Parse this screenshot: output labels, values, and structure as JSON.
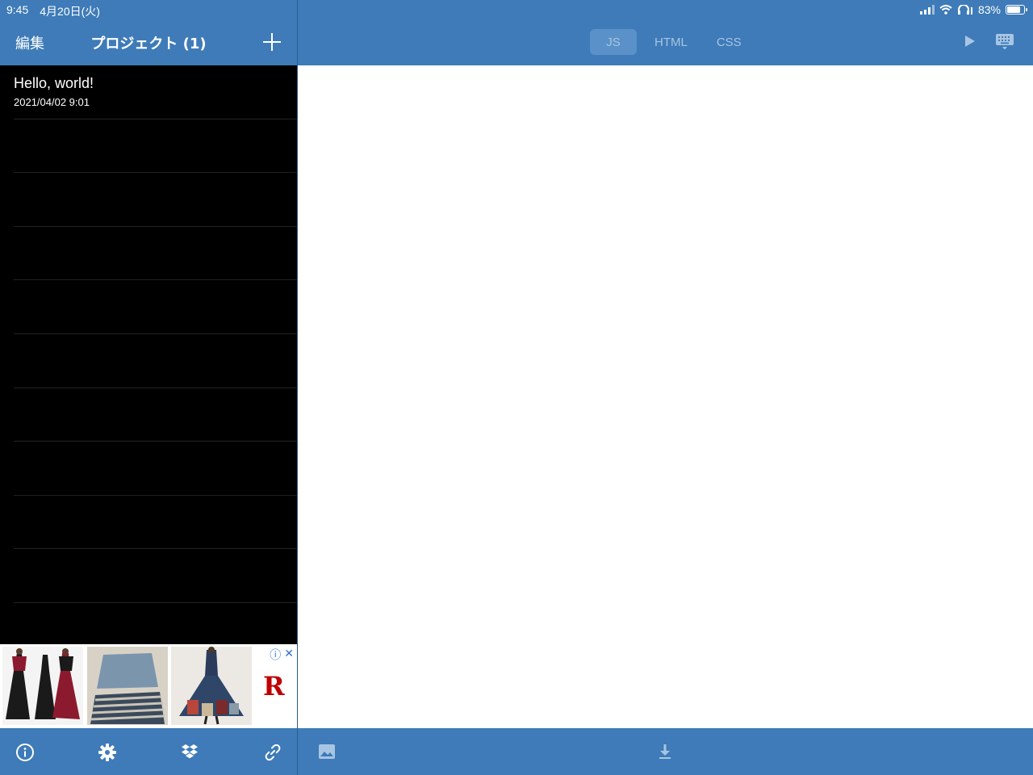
{
  "status_bar": {
    "time": "9:45",
    "date": "4月20日(火)",
    "battery": "83%",
    "battery_level": 0.83
  },
  "sidebar": {
    "edit_label": "編集",
    "title": "プロジェクト (1)",
    "projects": [
      {
        "name": "Hello, world!",
        "date": "2021/04/02 9:01"
      }
    ]
  },
  "editor": {
    "tabs": [
      {
        "label": "JS",
        "active": true
      },
      {
        "label": "HTML",
        "active": false
      },
      {
        "label": "CSS",
        "active": false
      }
    ]
  },
  "colors": {
    "header_bg": "#3e7bb8",
    "sidebar_bg": "#000000",
    "editor_bg": "#ffffff"
  },
  "icons": {
    "sidebar_toolbar": [
      "info-icon",
      "gear-icon",
      "dropbox-icon",
      "link-icon"
    ],
    "main_toolbar": [
      "image-icon",
      "download-icon"
    ],
    "header": [
      "plus-icon",
      "play-icon",
      "keyboard-icon"
    ]
  }
}
